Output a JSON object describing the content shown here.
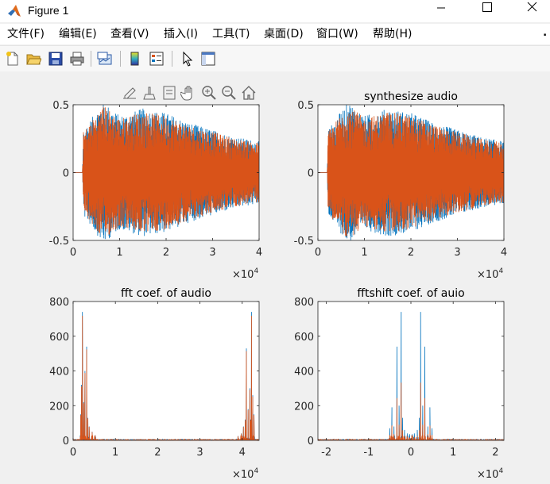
{
  "window": {
    "title": "Figure 1",
    "icon": "matlab-logo-icon",
    "controls": [
      "minimize-icon",
      "maximize-icon",
      "close-icon"
    ]
  },
  "menu": {
    "items": [
      "文件(F)",
      "编辑(E)",
      "查看(V)",
      "插入(I)",
      "工具(T)",
      "桌面(D)",
      "窗口(W)",
      "帮助(H)"
    ],
    "overflow": "⬝"
  },
  "toolbar": {
    "buttons": [
      "new-figure-icon",
      "open-file-icon",
      "save-icon",
      "print-icon",
      "link-plot-icon",
      "insert-colorbar-icon",
      "insert-legend-icon",
      "edit-plot-arrow-icon",
      "property-inspector-icon"
    ]
  },
  "axes_toolbar": {
    "buttons": [
      "export-icon",
      "brush-icon",
      "data-tips-icon",
      "pan-hand-icon",
      "zoom-in-icon",
      "zoom-out-icon",
      "home-icon"
    ]
  },
  "colors": {
    "series1": "#0072bd",
    "series2": "#d95319"
  },
  "chart_data": [
    {
      "type": "line",
      "title": "",
      "xlabel": "",
      "ylabel": "",
      "xlim": [
        0,
        40000
      ],
      "ylim": [
        -0.5,
        0.5
      ],
      "xticks": [
        0,
        1,
        2,
        3,
        4
      ],
      "xtick_labels": [
        "0",
        "1",
        "2",
        "3",
        "4"
      ],
      "yticks": [
        -0.5,
        0,
        0.5
      ],
      "ytick_labels": [
        "-0.5",
        "0",
        "0.5"
      ],
      "x_exponent": "×10^4",
      "series": [
        {
          "color": "#0072bd",
          "description_points": [
            [
              0,
              0
            ],
            [
              2000,
              0
            ],
            [
              2200,
              0.3
            ],
            [
              6500,
              0.5
            ],
            [
              10000,
              0.4
            ],
            [
              15000,
              0.45
            ],
            [
              20000,
              0.42
            ],
            [
              25000,
              0.35
            ],
            [
              30000,
              0.3
            ],
            [
              35000,
              0.25
            ],
            [
              40000,
              0.22
            ]
          ]
        },
        {
          "color": "#d95319",
          "description_points": [
            [
              0,
              0
            ],
            [
              2000,
              0
            ],
            [
              2200,
              0.3
            ],
            [
              6500,
              0.5
            ],
            [
              10000,
              0.4
            ],
            [
              15000,
              0.45
            ],
            [
              20000,
              0.42
            ],
            [
              25000,
              0.35
            ],
            [
              30000,
              0.3
            ],
            [
              35000,
              0.25
            ],
            [
              40000,
              0.22
            ]
          ]
        }
      ]
    },
    {
      "type": "line",
      "title": "synthesize audio",
      "xlabel": "",
      "ylabel": "",
      "xlim": [
        0,
        40000
      ],
      "ylim": [
        -0.5,
        0.5
      ],
      "xticks": [
        0,
        1,
        2,
        3,
        4
      ],
      "xtick_labels": [
        "0",
        "1",
        "2",
        "3",
        "4"
      ],
      "yticks": [
        -0.5,
        0,
        0.5
      ],
      "ytick_labels": [
        "-0.5",
        "0",
        "0.5"
      ],
      "x_exponent": "×10^4",
      "series": [
        {
          "color": "#0072bd",
          "description_points": [
            [
              0,
              0
            ],
            [
              2000,
              0
            ],
            [
              2200,
              0.3
            ],
            [
              6500,
              0.5
            ],
            [
              10000,
              0.4
            ],
            [
              15000,
              0.45
            ],
            [
              20000,
              0.42
            ],
            [
              25000,
              0.35
            ],
            [
              30000,
              0.3
            ],
            [
              35000,
              0.25
            ],
            [
              40000,
              0.22
            ]
          ]
        },
        {
          "color": "#d95319",
          "description_points": [
            [
              0,
              0
            ],
            [
              2000,
              0
            ],
            [
              2200,
              0.3
            ],
            [
              6500,
              0.5
            ],
            [
              10000,
              0.4
            ],
            [
              15000,
              0.45
            ],
            [
              20000,
              0.42
            ],
            [
              25000,
              0.35
            ],
            [
              30000,
              0.3
            ],
            [
              35000,
              0.25
            ],
            [
              40000,
              0.22
            ]
          ]
        }
      ]
    },
    {
      "type": "line",
      "title": "fft coef. of audio",
      "xlabel": "",
      "ylabel": "",
      "xlim": [
        0,
        44000
      ],
      "ylim": [
        0,
        800
      ],
      "xticks": [
        0,
        1,
        2,
        3,
        4
      ],
      "xtick_labels": [
        "0",
        "1",
        "2",
        "3",
        "4"
      ],
      "yticks": [
        0,
        200,
        400,
        600,
        800
      ],
      "ytick_labels": [
        "0",
        "200",
        "400",
        "600",
        "800"
      ],
      "x_exponent": "×10^4",
      "peaks": [
        [
          1800,
          150
        ],
        [
          2000,
          320
        ],
        [
          2200,
          740
        ],
        [
          2500,
          220
        ],
        [
          2800,
          400
        ],
        [
          3200,
          540
        ],
        [
          3500,
          130
        ],
        [
          3800,
          80
        ],
        [
          4500,
          50
        ],
        [
          5200,
          30
        ],
        [
          39000,
          25
        ],
        [
          39800,
          40
        ],
        [
          40300,
          80
        ],
        [
          40700,
          120
        ],
        [
          41000,
          530
        ],
        [
          41400,
          180
        ],
        [
          41800,
          300
        ],
        [
          42000,
          120
        ],
        [
          42200,
          740
        ],
        [
          42500,
          260
        ],
        [
          42800,
          150
        ]
      ],
      "series": [
        {
          "color": "#0072bd"
        },
        {
          "color": "#d95319"
        }
      ]
    },
    {
      "type": "line",
      "title": "fftshift coef. of auio",
      "xlabel": "",
      "ylabel": "",
      "xlim": [
        -22000,
        22000
      ],
      "ylim": [
        0,
        800
      ],
      "xticks": [
        -2,
        -1,
        0,
        1,
        2
      ],
      "xtick_labels": [
        "-2",
        "-1",
        "0",
        "1",
        "2"
      ],
      "yticks": [
        0,
        200,
        400,
        600,
        800
      ],
      "ytick_labels": [
        "0",
        "200",
        "400",
        "600",
        "800"
      ],
      "x_exponent": "×10^4",
      "peaks": [
        [
          -5000,
          70
        ],
        [
          -4500,
          190
        ],
        [
          -4000,
          80
        ],
        [
          -3300,
          540
        ],
        [
          -2800,
          200
        ],
        [
          -2300,
          740
        ],
        [
          -2000,
          130
        ],
        [
          -1500,
          60
        ],
        [
          -800,
          40
        ],
        [
          -300,
          35
        ],
        [
          300,
          35
        ],
        [
          800,
          40
        ],
        [
          1500,
          60
        ],
        [
          2000,
          130
        ],
        [
          2300,
          740
        ],
        [
          2800,
          200
        ],
        [
          3300,
          540
        ],
        [
          4000,
          80
        ],
        [
          4500,
          190
        ],
        [
          5000,
          70
        ]
      ],
      "series": [
        {
          "color": "#0072bd"
        },
        {
          "color": "#d95319"
        }
      ]
    }
  ]
}
